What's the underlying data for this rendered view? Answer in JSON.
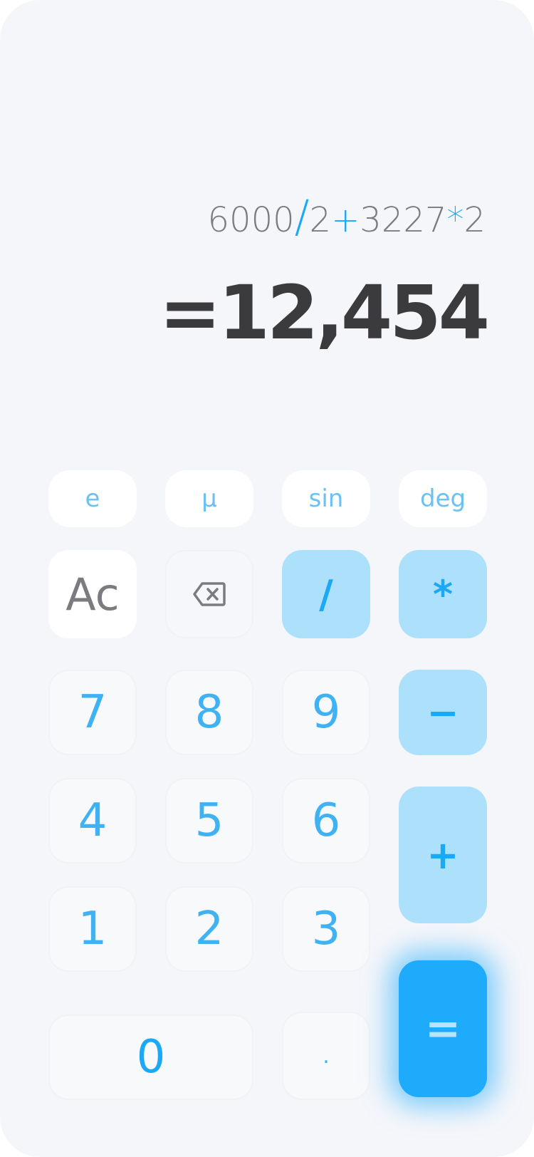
{
  "display": {
    "expression": [
      {
        "text": "6000",
        "op": false
      },
      {
        "text": "/",
        "op": true
      },
      {
        "text": "2",
        "op": false
      },
      {
        "text": "+",
        "op": true
      },
      {
        "text": "3227",
        "op": false
      },
      {
        "text": "*",
        "op": true
      },
      {
        "text": "2",
        "op": false
      }
    ],
    "result": "=12,454"
  },
  "keys": {
    "e": "e",
    "mu": "µ",
    "sin": "sin",
    "deg": "deg",
    "ac": "Ac",
    "divide": "/",
    "multiply": "*",
    "seven": "7",
    "eight": "8",
    "nine": "9",
    "minus": "−",
    "four": "4",
    "five": "5",
    "six": "6",
    "plus": "+",
    "one": "1",
    "two": "2",
    "three": "3",
    "zero": "0",
    "dot": ".",
    "equals": "="
  },
  "icons": {
    "backspace": "backspace-icon"
  },
  "colors": {
    "accent": "#1eabfc",
    "operator_bg": "#ade1fb",
    "result_text": "#3b3b3e",
    "expression_text": "#7b7b80"
  }
}
